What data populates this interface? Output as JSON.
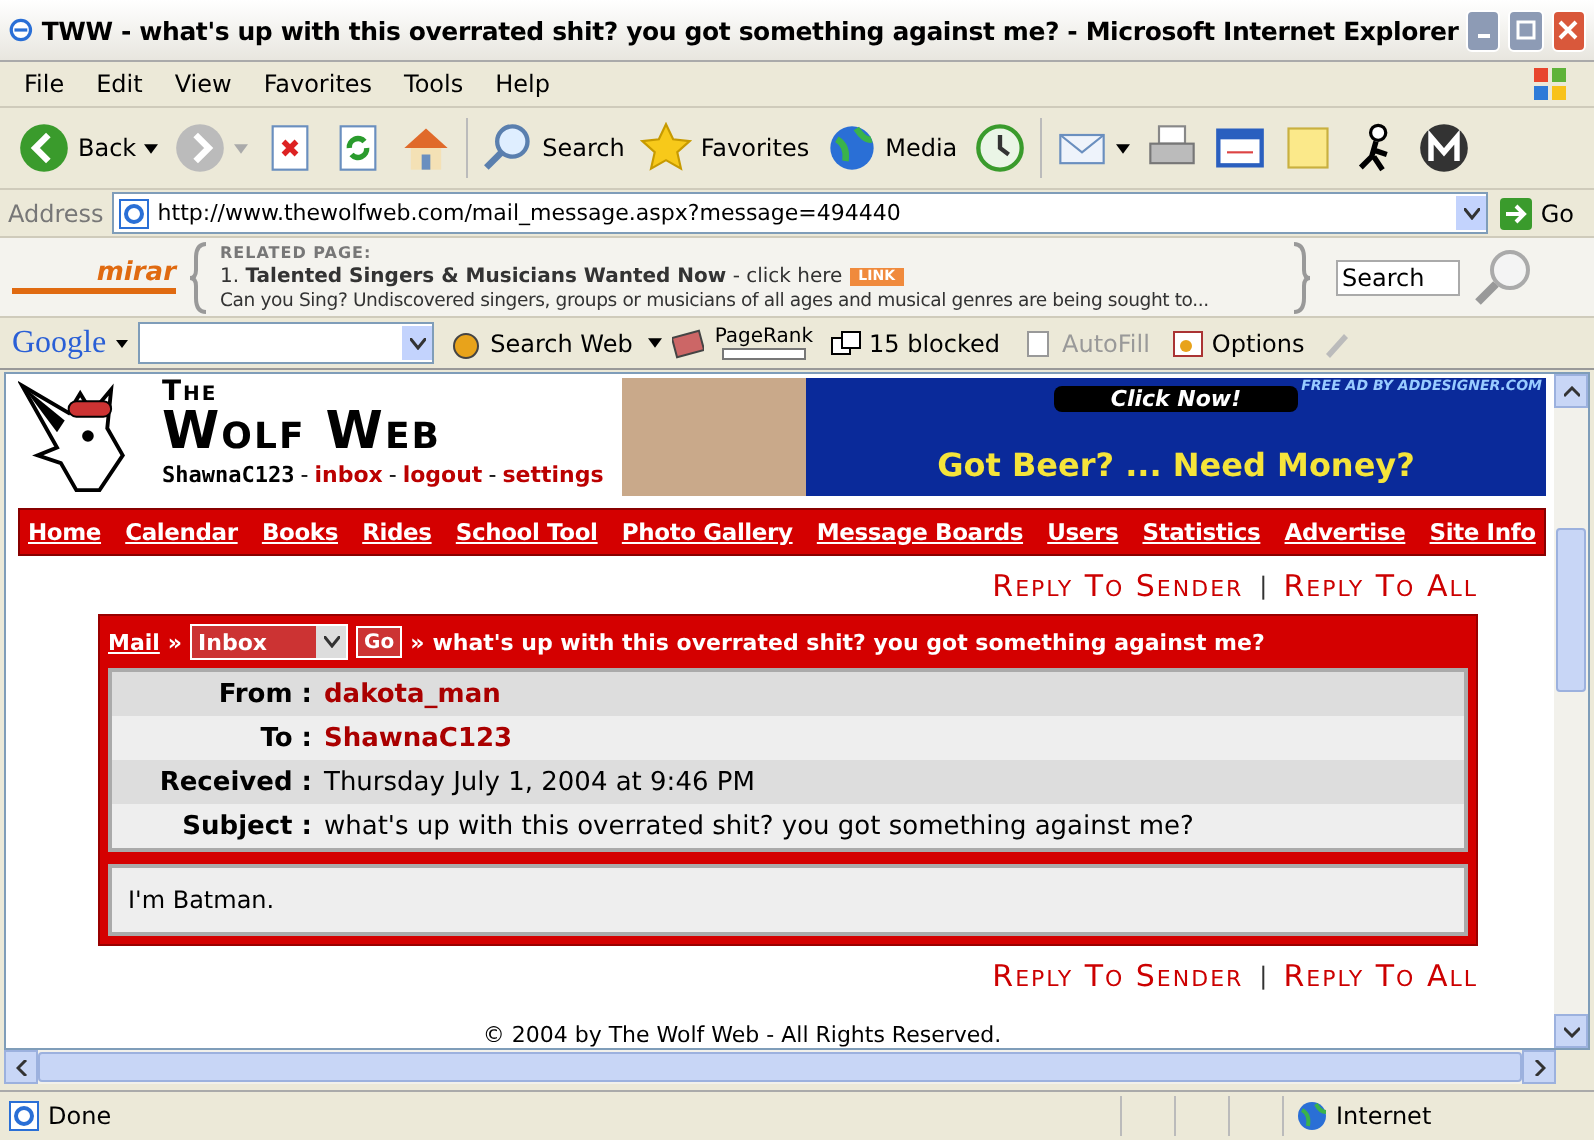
{
  "window": {
    "title": "TWW - what's up with this overrated shit? you got something against me? - Microsoft Internet Explorer"
  },
  "menu": [
    "File",
    "Edit",
    "View",
    "Favorites",
    "Tools",
    "Help"
  ],
  "toolbar": [
    {
      "kind": "back",
      "label": "Back"
    },
    {
      "kind": "forward"
    },
    {
      "kind": "stop"
    },
    {
      "kind": "refresh"
    },
    {
      "kind": "home"
    },
    {
      "kind": "search",
      "label": "Search"
    },
    {
      "kind": "favorites",
      "label": "Favorites"
    },
    {
      "kind": "media",
      "label": "Media"
    },
    {
      "kind": "history"
    },
    {
      "kind": "mail"
    },
    {
      "kind": "print"
    },
    {
      "kind": "edit"
    },
    {
      "kind": "note"
    },
    {
      "kind": "messenger"
    },
    {
      "kind": "m"
    }
  ],
  "address": {
    "label": "Address",
    "url": "http://www.thewolfweb.com/mail_message.aspx?message=494440",
    "go": "Go"
  },
  "mirar": {
    "logo": "mirar",
    "heading": "RELATED PAGE:",
    "item_number": "1.",
    "item_title": "Talented Singers & Musicians Wanted Now",
    "click": "- click here",
    "badge": "LINK",
    "description": "Can you Sing? Undiscovered singers, groups or musicians of all ages and musical genres are being sought to...",
    "search": "Search"
  },
  "google": {
    "logo": "Google",
    "search_web": "Search Web",
    "pagerank": "PageRank",
    "blocked": "15 blocked",
    "autofill": "AutoFill",
    "options": "Options"
  },
  "site": {
    "logo_the": "The",
    "logo_name": "Wolf Web",
    "user": "ShawnaC123",
    "user_links": [
      "inbox",
      "logout",
      "settings"
    ],
    "user_separators": [
      "-",
      "-",
      "-"
    ],
    "ad": {
      "credit": "FREE AD BY ADDESIGNER.COM",
      "button": "Click Now!",
      "text": "Got Beer? ... Need Money?"
    }
  },
  "nav": [
    "Home",
    "Calendar",
    "Books",
    "Rides",
    "School Tool",
    "Photo Gallery",
    "Message Boards",
    "Users",
    "Statistics",
    "Advertise",
    "Site Info"
  ],
  "reply_links": [
    "Reply To Sender",
    "Reply To All"
  ],
  "reply_separator": "|",
  "message": {
    "crumb": "Mail",
    "crumb_separators": [
      "»",
      "»"
    ],
    "folder": "Inbox",
    "go": "Go",
    "subject_title": "what's up with this overrated shit? you got something against me?",
    "fields": [
      {
        "label": "From :",
        "value": "dakota_man",
        "kind": "link"
      },
      {
        "label": "To :",
        "value": "ShawnaC123",
        "kind": "link"
      },
      {
        "label": "Received :",
        "value": "Thursday July 1, 2004 at 9:46 PM",
        "kind": "text"
      },
      {
        "label": "Subject :",
        "value": "what's up with this overrated shit? you got something against me?",
        "kind": "text"
      }
    ],
    "body": "I'm Batman."
  },
  "reply_links_bottom": [
    "Reply To Sender",
    "Reply To All"
  ],
  "reply_separator_bottom": "|",
  "footer": "© 2004 by The Wolf Web - All Rights Reserved.",
  "status_bar": {
    "text": "Done",
    "zone": "Internet"
  }
}
